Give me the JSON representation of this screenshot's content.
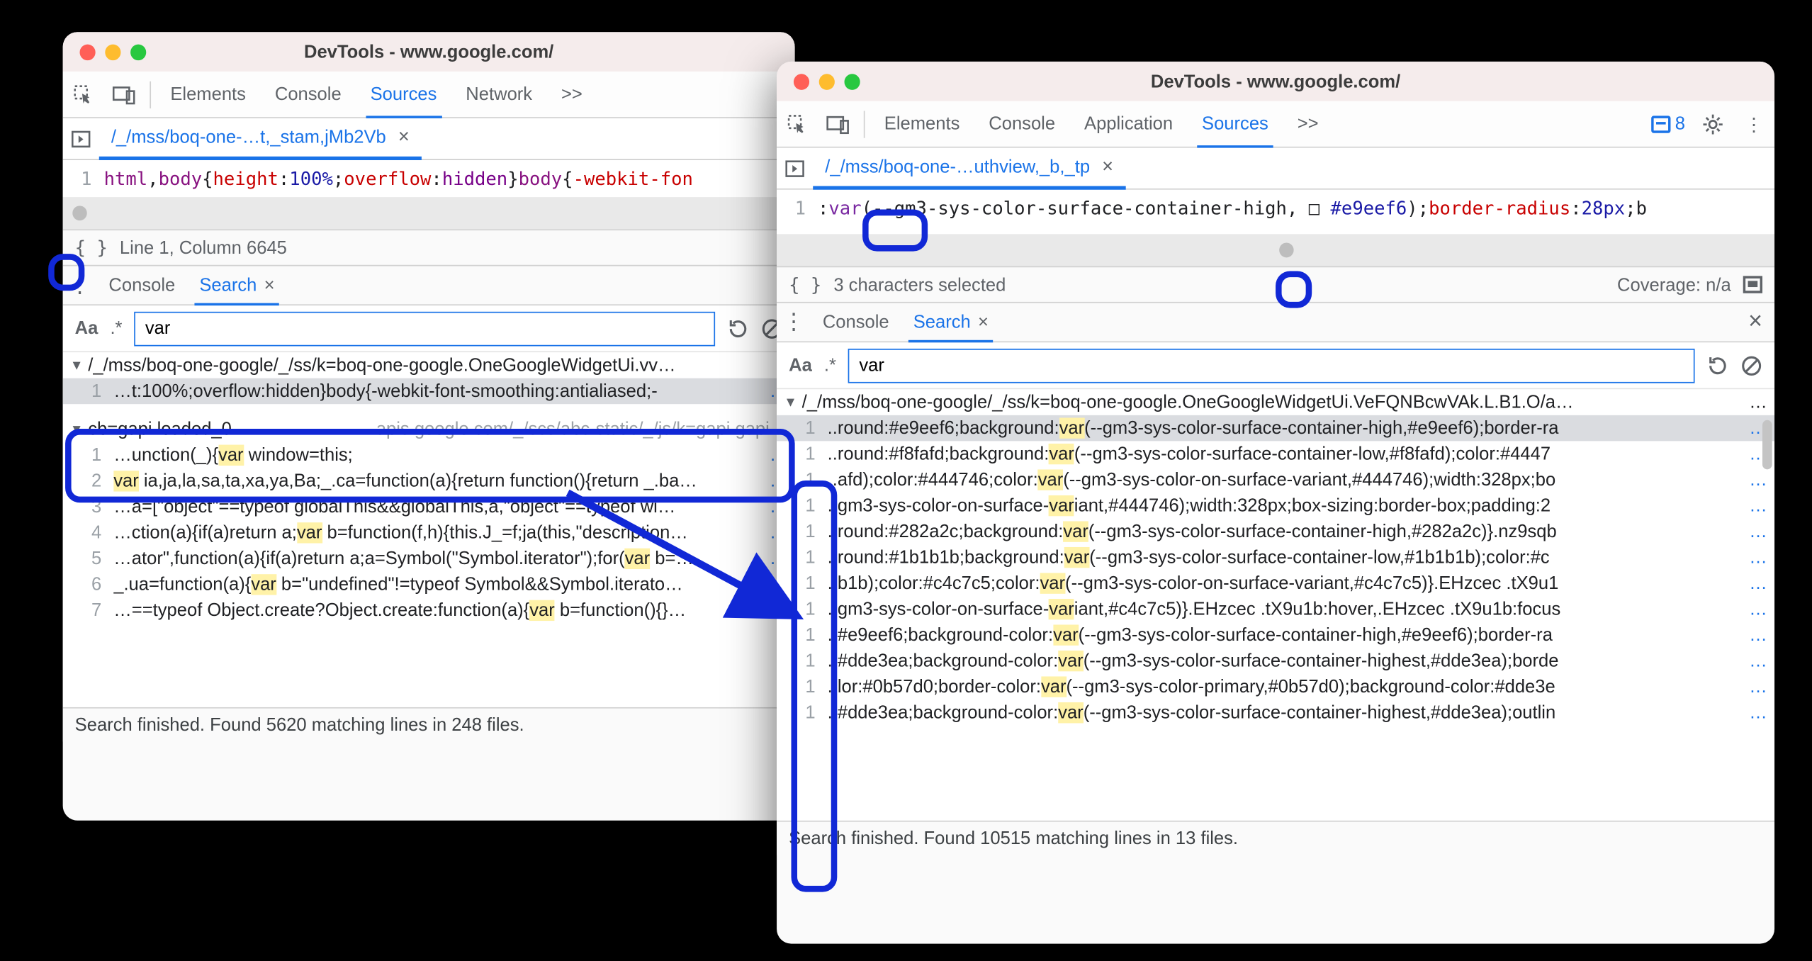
{
  "left": {
    "title": "DevTools - www.google.com/",
    "tabs": [
      "Elements",
      "Console",
      "Sources",
      "Network"
    ],
    "active_tab": "Sources",
    "more_glyph": ">>",
    "file_tab": "/_/mss/boq-one-…t,_stam,jMb2Vb",
    "editor_line_no": "1",
    "code_html": "<span class='tok-tag'>html</span>,<span class='tok-tag'>body</span>{<span class='tok-prop'>height</span>:<span class='tok-num'>100%</span>;<span class='tok-prop'>overflow</span>:<span class='tok-kw'>hidden</span>}<span class='tok-tag'>body</span>{<span class='tok-prop'>-webkit-fon</span>",
    "status": "Line 1, Column 6645",
    "drawer_tabs": [
      "Console",
      "Search"
    ],
    "drawer_active": "Search",
    "search_value": "var",
    "groups": [
      {
        "header": "/_/mss/boq-one-google/_/ss/k=boq-one-google.OneGoogleWidgetUi.vv…",
        "origin": "",
        "lines": [
          {
            "n": "1",
            "pre": "…t:100%;overflow:hidden}body{-webkit-font-smoothing:antialiased;-",
            "sel": true
          }
        ]
      },
      {
        "header": "cb=gapi.loaded_0",
        "origin": "apis.google.com/_/scs/abc-static/_/js/k=gapi.gapi…",
        "lines": [
          {
            "n": "1",
            "pre": "…unction(_){",
            "hl": "var",
            "post": " window=this;"
          },
          {
            "n": "2",
            "prehl": "var",
            "post2": " ia,ja,la,sa,ta,xa,ya,Ba;_.ca=function(a){return function(){return _.ba…"
          },
          {
            "n": "3",
            "pre": "…a=[\"object\"==typeof globalThis&&globalThis,a,\"object\"==typeof wi…"
          },
          {
            "n": "4",
            "pre": "…ction(a){if(a)return a;",
            "hl": "var",
            "post": " b=function(f,h){this.J_=f;ja(this,\"description…"
          },
          {
            "n": "5",
            "pre": "…ator\",function(a){if(a)return a;a=Symbol(\"Symbol.iterator\");for(",
            "hl": "var",
            "post": " b=…"
          },
          {
            "n": "6",
            "pre": "_.ua=function(a){",
            "hl": "var",
            "post": " b=\"undefined\"!=typeof Symbol&&Symbol.iterato…"
          },
          {
            "n": "7",
            "pre": "…==typeof Object.create?Object.create:function(a){",
            "hl": "var",
            "post": " b=function(){}…"
          }
        ]
      }
    ],
    "footer": "Search finished.  Found 5620 matching lines in 248 files."
  },
  "right": {
    "title": "DevTools - www.google.com/",
    "tabs": [
      "Elements",
      "Console",
      "Application",
      "Sources"
    ],
    "active_tab": "Sources",
    "more_glyph": ">>",
    "messages_count": "8",
    "file_tab": "/_/mss/boq-one-…uthview,_b,_tp",
    "editor_line_no": "1",
    "code_html": ":<span class='tok-func'>var</span>(--gm3-sys-color-surface-container-high, □ <span class='tok-hex'>#e9eef6</span>);<span class='tok-prop'>border-radius</span>:<span class='tok-num'>28px</span>;b",
    "status": "3 characters selected",
    "coverage": "Coverage: n/a",
    "drawer_tabs": [
      "Console",
      "Search"
    ],
    "drawer_active": "Search",
    "search_value": "var",
    "group_header": "/_/mss/boq-one-google/_/ss/k=boq-one-google.OneGoogleWidgetUi.VeFQNBcwVAk.L.B1.O/a…",
    "lines": [
      {
        "n": "1",
        "pre": "..round:#e9eef6;background:",
        "hl": "var",
        "post": "(--gm3-sys-color-surface-container-high,#e9eef6);border-ra",
        "sel": true
      },
      {
        "n": "1",
        "pre": "..round:#f8fafd;background:",
        "hl": "var",
        "post": "(--gm3-sys-color-surface-container-low,#f8fafd);color:#4447"
      },
      {
        "n": "1",
        "pre": "..afd);color:#444746;color:",
        "hl": "var",
        "post": "(--gm3-sys-color-on-surface-variant,#444746);width:328px;bo"
      },
      {
        "n": "1",
        "pre": "..gm3-sys-color-on-surface-",
        "hl": "var",
        "post": "iant,#444746);width:328px;box-sizing:border-box;padding:2"
      },
      {
        "n": "1",
        "pre": "..round:#282a2c;background:",
        "hl": "var",
        "post": "(--gm3-sys-color-surface-container-high,#282a2c)}.nz9sqb"
      },
      {
        "n": "1",
        "pre": "..round:#1b1b1b;background:",
        "hl": "var",
        "post": "(--gm3-sys-color-surface-container-low,#1b1b1b);color:#c"
      },
      {
        "n": "1",
        "pre": "..b1b);color:#c4c7c5;color:",
        "hl": "var",
        "post": "(--gm3-sys-color-on-surface-variant,#c4c7c5)}.EHzcec .tX9u1"
      },
      {
        "n": "1",
        "pre": "..gm3-sys-color-on-surface-",
        "hl": "var",
        "post": "iant,#c4c7c5)}.EHzcec .tX9u1b:hover,.EHzcec .tX9u1b:focus"
      },
      {
        "n": "1",
        "pre": "..#e9eef6;background-color:",
        "hl": "var",
        "post": "(--gm3-sys-color-surface-container-high,#e9eef6);border-ra"
      },
      {
        "n": "1",
        "pre": "..#dde3ea;background-color:",
        "hl": "var",
        "post": "(--gm3-sys-color-surface-container-highest,#dde3ea);borde"
      },
      {
        "n": "1",
        "pre": "..lor:#0b57d0;border-color:",
        "hl": "var",
        "post": "(--gm3-sys-color-primary,#0b57d0);background-color:#dde3e"
      },
      {
        "n": "1",
        "pre": "..#dde3ea;background-color:",
        "hl": "var",
        "post": "(--gm3-sys-color-surface-container-highest,#dde3ea);outlin"
      }
    ],
    "footer": "Search finished.  Found 10515 matching lines in 13 files."
  }
}
